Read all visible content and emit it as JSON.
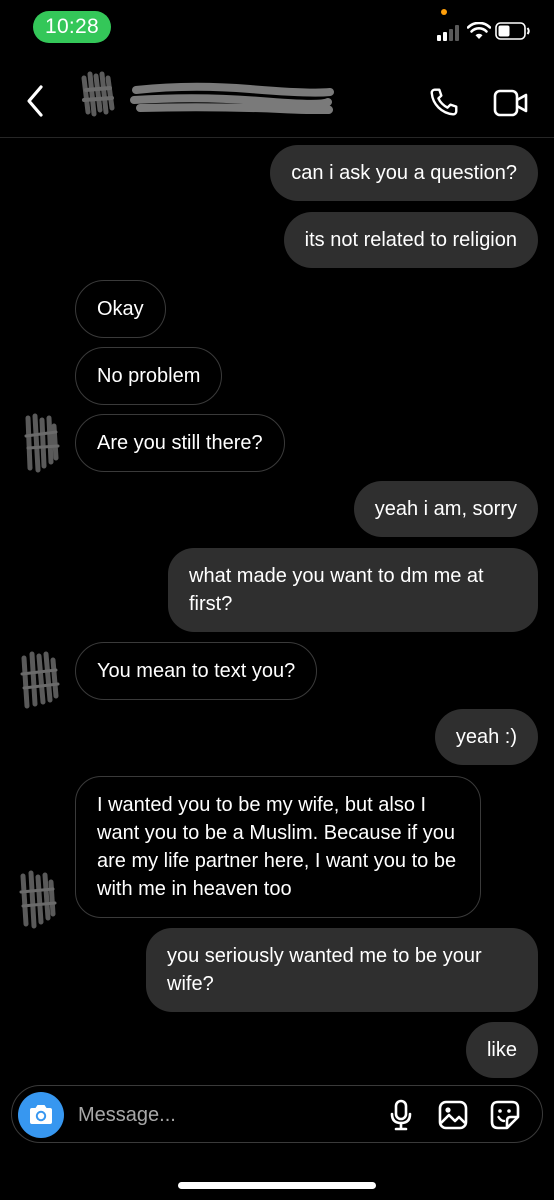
{
  "status_bar": {
    "time": "10:28",
    "icons": [
      "signal-icon",
      "wifi-icon",
      "battery-icon"
    ],
    "time_pill_color": "#34c759",
    "privacy_dot_color": "#ff9f0a"
  },
  "header": {
    "contact_name": "",
    "icons": [
      "back-icon",
      "call-icon",
      "video-call-icon"
    ]
  },
  "messages": [
    {
      "direction": "outgoing",
      "text": "can i ask you a question?"
    },
    {
      "direction": "outgoing",
      "text": "its not related to religion"
    },
    {
      "direction": "incoming",
      "text": "Okay"
    },
    {
      "direction": "incoming",
      "text": "No problem"
    },
    {
      "direction": "incoming",
      "text": "Are you still there?"
    },
    {
      "direction": "outgoing",
      "text": "yeah i am, sorry"
    },
    {
      "direction": "outgoing",
      "text": "what made you want to dm me at first?"
    },
    {
      "direction": "incoming",
      "text": "You mean to text you?"
    },
    {
      "direction": "outgoing",
      "text": "yeah :)"
    },
    {
      "direction": "incoming",
      "text": "I wanted you to be my wife, but also I want you to be a Muslim.  Because if you are my life partner here, I want you to be with me in heaven too"
    },
    {
      "direction": "outgoing",
      "text": "you seriously wanted me to be your wife?"
    },
    {
      "direction": "outgoing",
      "text": "like"
    }
  ],
  "composer": {
    "placeholder": "Message...",
    "icons": [
      "camera-icon",
      "microphone-icon",
      "gallery-icon",
      "sticker-icon"
    ],
    "camera_button_color": "#3797f0"
  },
  "colors": {
    "background": "#000000",
    "outgoing_bubble": "#2f2f2f",
    "incoming_border": "#3a3a3a"
  }
}
